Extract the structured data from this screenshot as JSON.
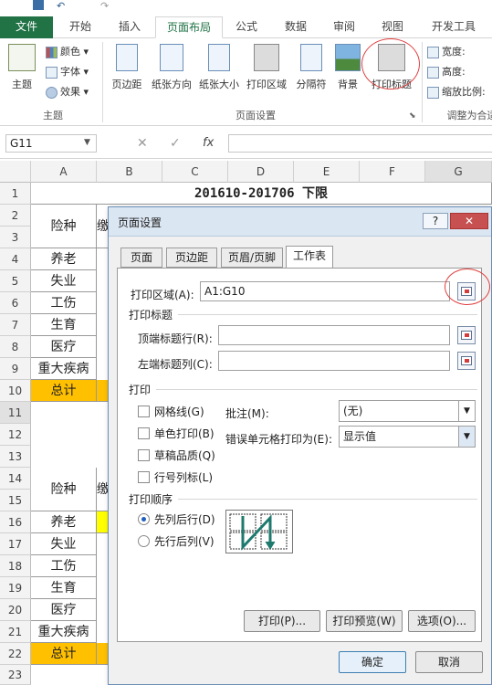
{
  "ribbon_tabs": [
    "文件",
    "开始",
    "插入",
    "页面布局",
    "公式",
    "数据",
    "审阅",
    "视图",
    "开发工具"
  ],
  "ribbon": {
    "theme_group": {
      "themes_label": "主题",
      "colors_label": "颜色",
      "fonts_label": "字体",
      "effects_label": "效果",
      "group_label": "主题"
    },
    "page_setup_buttons": [
      "页边距",
      "纸张方向",
      "纸张大小",
      "打印区域",
      "分隔符",
      "背景",
      "打印标题"
    ],
    "page_setup_group_label": "页面设置",
    "scale_group": {
      "width_label": "宽度:",
      "height_label": "高度:",
      "scale_label": "缩放比例:",
      "group_label": "调整为合适"
    }
  },
  "formula_bar": {
    "namebox": "G11",
    "fx": "fx"
  },
  "sheet": {
    "columns": [
      "A",
      "B",
      "C",
      "D",
      "E",
      "F",
      "G"
    ],
    "rows": [
      "1",
      "2",
      "3",
      "4",
      "5",
      "6",
      "7",
      "8",
      "9",
      "10",
      "11",
      "12",
      "13",
      "14",
      "15",
      "16",
      "17",
      "18",
      "19",
      "20",
      "21",
      "22",
      "23"
    ],
    "title": "201610-201706  下限",
    "header1": "险种",
    "header_partial": "缴",
    "block1": [
      "养老",
      "失业",
      "工伤",
      "生育",
      "医疗",
      "重大疾病",
      "总计"
    ],
    "header2": "险种",
    "block2": [
      "养老",
      "失业",
      "工伤",
      "生育",
      "医疗",
      "重大疾病",
      "总计"
    ]
  },
  "dialog": {
    "title": "页面设置",
    "help": "?",
    "close": "✕",
    "tabs": [
      "页面",
      "页边距",
      "页眉/页脚",
      "工作表"
    ],
    "print_area_label": "打印区域(A):",
    "print_area_value": "A1:G10",
    "print_titles_section": "打印标题",
    "top_rows_label": "顶端标题行(R):",
    "left_cols_label": "左端标题列(C):",
    "print_section": "打印",
    "checkboxes": [
      "网格线(G)",
      "单色打印(B)",
      "草稿品质(Q)",
      "行号列标(L)"
    ],
    "comments_label": "批注(M):",
    "comments_value": "(无)",
    "errors_label": "错误单元格打印为(E):",
    "errors_value": "显示值",
    "order_section": "打印顺序",
    "order_options": [
      "先列后行(D)",
      "先行后列(V)"
    ],
    "btn_print": "打印(P)...",
    "btn_preview": "打印预览(W)",
    "btn_options": "选项(O)...",
    "btn_ok": "确定",
    "btn_cancel": "取消"
  },
  "colors": {
    "excel_green": "#217346",
    "total_fill": "#ffc000",
    "highlight_fill": "#ffff00",
    "annotation": "#e04040"
  }
}
